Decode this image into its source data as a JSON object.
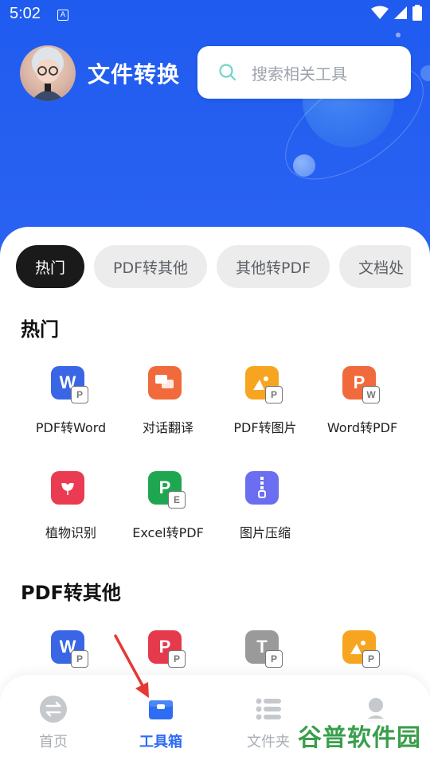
{
  "status": {
    "time": "5:02",
    "notif": "A"
  },
  "header": {
    "title": "文件转换"
  },
  "search": {
    "placeholder": "搜索相关工具"
  },
  "tabs": [
    {
      "label": "热门",
      "active": true
    },
    {
      "label": "PDF转其他"
    },
    {
      "label": "其他转PDF"
    },
    {
      "label": "文档处"
    }
  ],
  "sections": {
    "hot": {
      "title": "热门",
      "tools": [
        {
          "label": "PDF转Word",
          "icon": "word-doc-icon",
          "glyph": "W",
          "badge": "P",
          "color": "#3a66e5"
        },
        {
          "label": "对话翻译",
          "icon": "chat-translate-icon",
          "glyph": "",
          "badge": "",
          "color": "#f06a3b"
        },
        {
          "label": "PDF转图片",
          "icon": "image-icon",
          "glyph": "",
          "badge": "P",
          "color": "#f7a521"
        },
        {
          "label": "Word转PDF",
          "icon": "pdf-doc-icon",
          "glyph": "P",
          "badge": "W",
          "color": "#f06a3b"
        },
        {
          "label": "植物识别",
          "icon": "plant-icon",
          "glyph": "",
          "badge": "",
          "color": "#ea3b52"
        },
        {
          "label": "Excel转PDF",
          "icon": "pdf-doc-icon",
          "glyph": "P",
          "badge": "E",
          "color": "#1fa651"
        },
        {
          "label": "图片压缩",
          "icon": "zip-icon",
          "glyph": "",
          "badge": "",
          "color": "#6b6ef0"
        }
      ]
    },
    "pdf_to_other": {
      "title": "PDF转其他",
      "tools": [
        {
          "icon": "word-doc-icon",
          "glyph": "W",
          "badge": "P",
          "color": "#3a66e5"
        },
        {
          "icon": "pdf-doc-icon",
          "glyph": "P",
          "badge": "P",
          "color": "#e53a4c"
        },
        {
          "icon": "text-doc-icon",
          "glyph": "T",
          "badge": "P",
          "color": "#9a9a9a"
        },
        {
          "icon": "image-icon",
          "glyph": "",
          "badge": "P",
          "color": "#f7a521"
        }
      ]
    }
  },
  "nav": [
    {
      "label": "首页",
      "icon": "home-icon",
      "active": false
    },
    {
      "label": "工具箱",
      "icon": "toolbox-icon",
      "active": true
    },
    {
      "label": "文件夹",
      "icon": "folder-list-icon",
      "active": false
    },
    {
      "label": "",
      "icon": "profile-icon",
      "active": false
    }
  ],
  "watermark": "谷普软件园",
  "colors": {
    "primary": "#1f5bef",
    "accent": "#2d6cf3"
  }
}
